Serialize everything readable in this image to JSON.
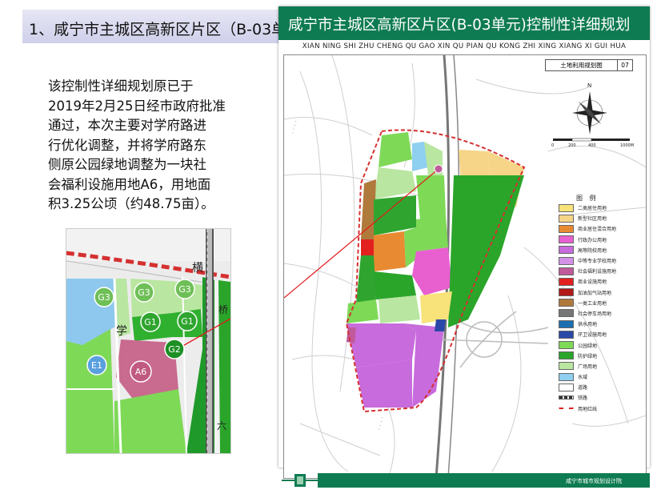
{
  "slide": {
    "title": "1、咸宁市主城区高新区片区（B-03单",
    "description_lines": [
      "该控制性详细规划原已于",
      "2019年2月25日经市政府批准",
      "通过，本次主要对学府路进",
      "行优化调整，并将学府路东",
      "侧原公园绿地调整为一块社",
      "会福利设施用地A6，用地面",
      "积3.25公顷（约48.75亩）。"
    ]
  },
  "inset": {
    "labels": {
      "g3a": "G3",
      "g3b": "G3",
      "g3c": "G3",
      "g1a": "G1",
      "g1b": "G1",
      "g2": "G2",
      "e1": "E1",
      "a6": "A6"
    },
    "road_chars": {
      "heng": "横",
      "xue": "学",
      "qiao": "桥",
      "liu": "六"
    }
  },
  "map": {
    "title": "咸宁市主城区高新区片区(B-03单元)控制性详细规划",
    "pinyin": "XIAN NING SHI ZHU CHENG QU GAO XIN QU PIAN QU KONG ZHI XING XIANG XI GUI HUA",
    "sheet_name": "土地利用规划图",
    "sheet_no": "07",
    "compass_n": "N",
    "scale": {
      "s0": "0",
      "s1": "200",
      "s2": "400",
      "s3": "1000M"
    },
    "legend_title": "图 例",
    "legend": [
      {
        "label": "二类居住用地",
        "color": "#f8e27a",
        "code": "R2"
      },
      {
        "label": "新型社区用地",
        "color": "#f6d588",
        "code": "R"
      },
      {
        "label": "商业居住混合用地",
        "color": "#e88a32",
        "code": "B"
      },
      {
        "label": "行政办公用地",
        "color": "#e860d0",
        "code": "A1"
      },
      {
        "label": "高等院校用地",
        "color": "#c86bdc",
        "code": "A3"
      },
      {
        "label": "中等专业学校用地",
        "color": "#d491e8",
        "code": "A3"
      },
      {
        "label": "社会福利设施用地",
        "color": "#c05a9a",
        "code": "A6"
      },
      {
        "label": "商业设施用地",
        "color": "#e22020",
        "code": "B1"
      },
      {
        "label": "加油加气站用地",
        "color": "#b21a1a",
        "code": "B4"
      },
      {
        "label": "一类工业用地",
        "color": "#b07a3c",
        "code": "M1"
      },
      {
        "label": "社会停车场用地",
        "color": "#777777",
        "code": "S4"
      },
      {
        "label": "供水用地",
        "color": "#1b6fb0",
        "code": "U1"
      },
      {
        "label": "环卫设施用地",
        "color": "#2a48a8",
        "code": "U2"
      },
      {
        "label": "公园绿地",
        "color": "#7ed957",
        "code": "G1"
      },
      {
        "label": "防护绿地",
        "color": "#2aa52a",
        "code": "G2"
      },
      {
        "label": "广场用地",
        "color": "#b9e6a0",
        "code": "G3"
      },
      {
        "label": "水域",
        "color": "#8fcff0",
        "code": "E1"
      },
      {
        "label": "道路",
        "color": "#ffffff",
        "code": ""
      },
      {
        "label": "铁路",
        "color": "#555555",
        "code": ""
      },
      {
        "label": "用地红线",
        "color": "#dd2222",
        "code": ""
      }
    ],
    "footer": "咸宁市城市规划设计院"
  }
}
